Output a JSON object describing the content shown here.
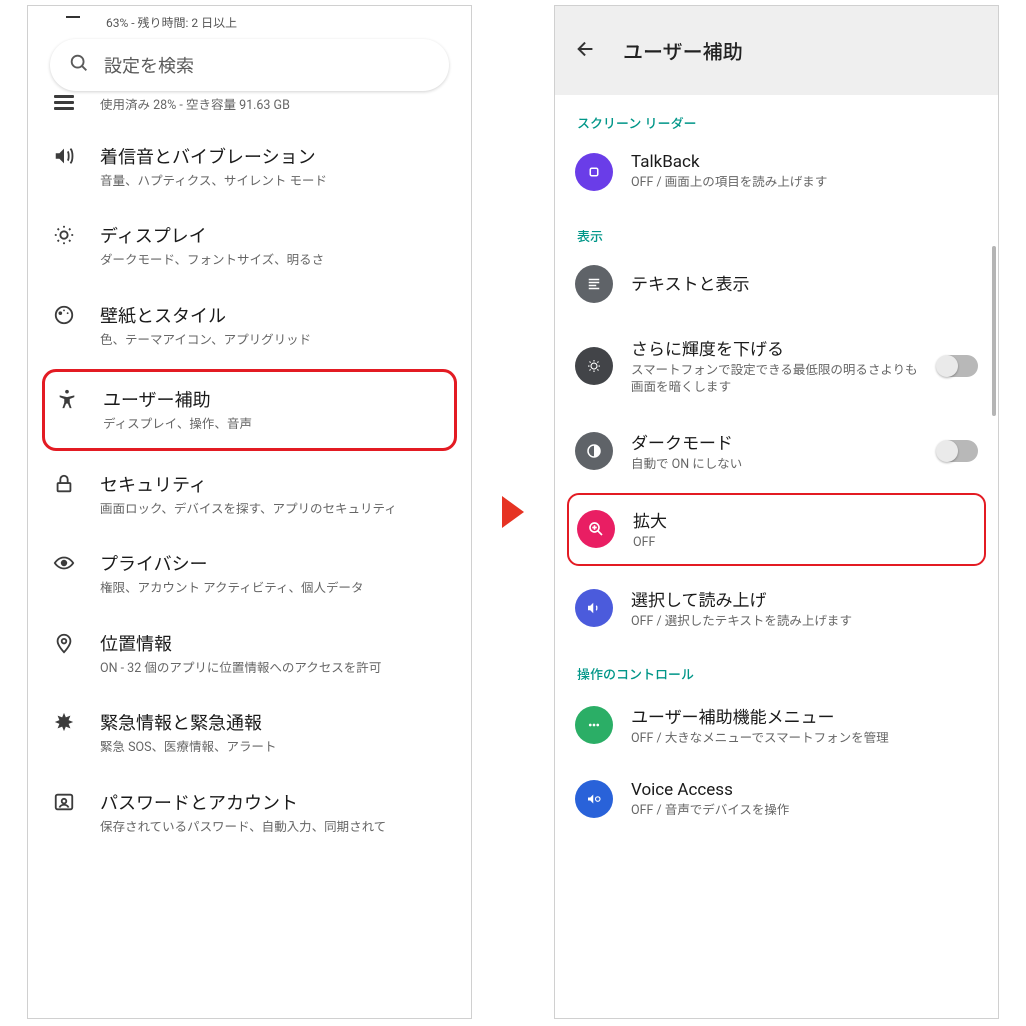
{
  "left": {
    "status_subtext": "63% - 残り時間: 2 日以上",
    "search_placeholder": "設定を検索",
    "storage_sub": "使用済み 28% - 空き容量 91.63 GB",
    "items": [
      {
        "title": "着信音とバイブレーション",
        "sub": "音量、ハプティクス、サイレント モード"
      },
      {
        "title": "ディスプレイ",
        "sub": "ダークモード、フォントサイズ、明るさ"
      },
      {
        "title": "壁紙とスタイル",
        "sub": "色、テーマアイコン、アプリグリッド"
      },
      {
        "title": "ユーザー補助",
        "sub": "ディスプレイ、操作、音声"
      },
      {
        "title": "セキュリティ",
        "sub": "画面ロック、デバイスを探す、アプリのセキュリティ"
      },
      {
        "title": "プライバシー",
        "sub": "権限、アカウント アクティビティ、個人データ"
      },
      {
        "title": "位置情報",
        "sub": "ON - 32 個のアプリに位置情報へのアクセスを許可"
      },
      {
        "title": "緊急情報と緊急通報",
        "sub": "緊急 SOS、医療情報、アラート"
      },
      {
        "title": "パスワードとアカウント",
        "sub": "保存されているパスワード、自動入力、同期されて"
      }
    ]
  },
  "right": {
    "header": "ユーザー補助",
    "sections": {
      "reader": "スクリーン リーダー",
      "display": "表示",
      "control": "操作のコントロール"
    },
    "items": {
      "talkback": {
        "title": "TalkBack",
        "sub": "OFF / 画面上の項目を読み上げます"
      },
      "text_display": {
        "title": "テキストと表示"
      },
      "dimmer": {
        "title": "さらに輝度を下げる",
        "sub": "スマートフォンで設定できる最低限の明るさよりも画面を暗くします"
      },
      "dark": {
        "title": "ダークモード",
        "sub": "自動で ON にしない"
      },
      "magnify": {
        "title": "拡大",
        "sub": "OFF"
      },
      "select_speak": {
        "title": "選択して読み上げ",
        "sub": "OFF / 選択したテキストを読み上げます"
      },
      "a11y_menu": {
        "title": "ユーザー補助機能メニュー",
        "sub": "OFF / 大きなメニューでスマートフォンを管理"
      },
      "voice": {
        "title": "Voice Access",
        "sub": "OFF / 音声でデバイスを操作"
      }
    }
  }
}
